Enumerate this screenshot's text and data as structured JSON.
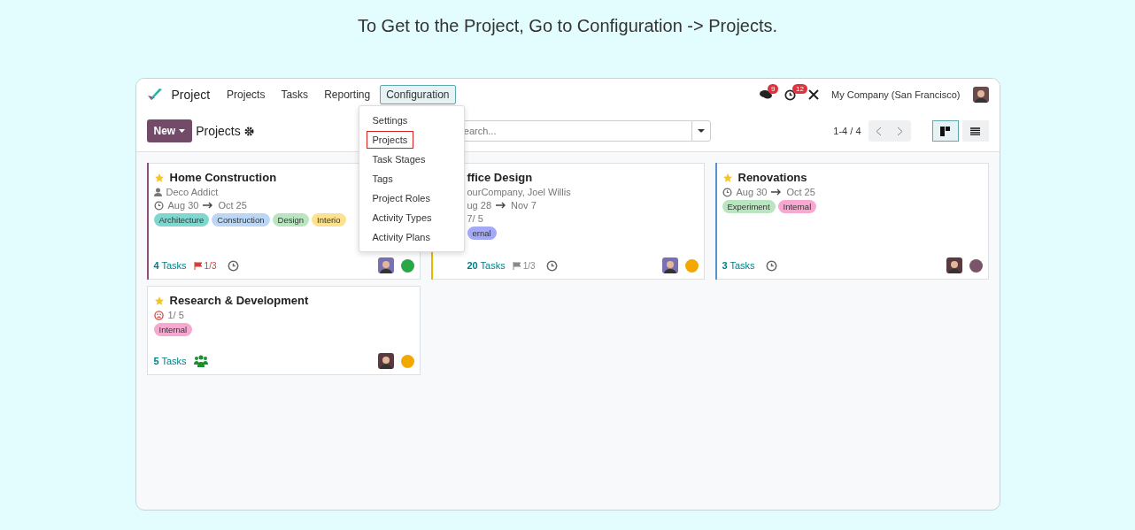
{
  "heading": "To Get to the Project, Go to Configuration -> Projects.",
  "app": {
    "brand": "Project",
    "menu": [
      {
        "label": "Projects",
        "selected": false
      },
      {
        "label": "Tasks",
        "selected": false
      },
      {
        "label": "Reporting",
        "selected": false
      },
      {
        "label": "Configuration",
        "selected": true
      }
    ],
    "dropdown": [
      {
        "label": "Settings",
        "highlighted": false
      },
      {
        "label": "Projects",
        "highlighted": true
      },
      {
        "label": "Task Stages",
        "highlighted": false
      },
      {
        "label": "Tags",
        "highlighted": false
      },
      {
        "label": "Project Roles",
        "highlighted": false
      },
      {
        "label": "Activity Types",
        "highlighted": false
      },
      {
        "label": "Activity Plans",
        "highlighted": false
      }
    ],
    "systray": {
      "messages_badge": "9",
      "activities_badge": "12",
      "company": "My Company (San Francisco)"
    },
    "control": {
      "new_button": "New",
      "breadcrumb": "Projects",
      "search_placeholder": "earch...",
      "pager": "1-4 / 4",
      "views": [
        {
          "kind": "kanban",
          "selected": true
        },
        {
          "kind": "list",
          "selected": false
        }
      ]
    },
    "cards": [
      {
        "title": "Home Construction",
        "starred": true,
        "covered": false,
        "stripe": {
          "color": "#8e4f7e"
        },
        "partner": "Deco Addict",
        "dates": [
          "Aug 30",
          "Oct 25"
        ],
        "tags": [
          {
            "label": "Architecture",
            "color": "#7fd8d0"
          },
          {
            "label": "Construction",
            "color": "#bcd6f6"
          },
          {
            "label": "Design",
            "color": "#b9e6c0"
          },
          {
            "label": "Interio",
            "color": "#fce28f"
          }
        ],
        "tasks_count": "4",
        "tasks_label": "Tasks",
        "milestone": {
          "text": "1/3",
          "late": true
        },
        "clock": true,
        "status": {
          "color": "#28a745"
        }
      },
      {
        "title": "ffice Design",
        "covered": true,
        "stripe": {
          "color": "#e9b600"
        },
        "partner": "ourCompany, Joel Willis",
        "dates": [
          "ug 28",
          "Nov 7"
        ],
        "rating": "7/ 5",
        "tags": [
          {
            "label": "ernal",
            "color": "#a4a9f6"
          }
        ],
        "tasks_count": "20",
        "tasks_label": "Tasks",
        "milestone": {
          "text": "1/3",
          "late": false
        },
        "clock": true,
        "status": {
          "color": "#f3a800"
        }
      },
      {
        "title": "Renovations",
        "starred": true,
        "covered": false,
        "stripe": {
          "color": "#5a8fd0"
        },
        "dates": [
          "Aug 30",
          "Oct 25"
        ],
        "tags": [
          {
            "label": "Experiment",
            "color": "#b9e6c0"
          },
          {
            "label": "Internal",
            "color": "#f7a8d0"
          }
        ],
        "tasks_count": "3",
        "tasks_label": "Tasks",
        "clock": true,
        "status": {
          "color": "#7a5468"
        }
      },
      {
        "title": "Research & Development",
        "starred": true,
        "covered": false,
        "rating": "1/ 5",
        "rating_sad": true,
        "tags": [
          {
            "label": "Internal",
            "color": "#f7a8d0"
          }
        ],
        "tasks_count": "5",
        "tasks_label": "Tasks",
        "team": true,
        "status": {
          "color": "#f3a800"
        }
      }
    ]
  }
}
